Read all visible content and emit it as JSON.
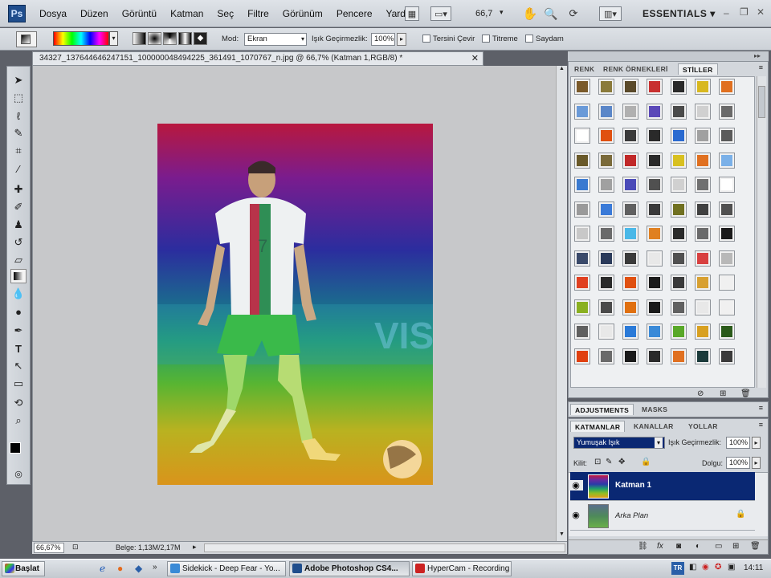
{
  "app": {
    "logo": "Ps"
  },
  "menu": [
    "Dosya",
    "Düzen",
    "Görüntü",
    "Katman",
    "Seç",
    "Filtre",
    "Görünüm",
    "Pencere",
    "Yardım"
  ],
  "zoom_readout": "66,7",
  "workspace": "ESSENTIALS",
  "options": {
    "mode_label": "Mod:",
    "mode_value": "Ekran",
    "opacity_label": "Işık Geçirmezlik:",
    "opacity_value": "100%",
    "reverse_label": "Tersini Çevir",
    "dither_label": "Titreme",
    "transparency_label": "Saydam"
  },
  "document": {
    "tab_title": "34327_137644646247151_100000048494225_361491_1070767_n.jpg @ 66,7% (Katman 1,RGB/8) *",
    "status_zoom": "66,67%",
    "status_doc": "Belge: 1,13M/2,17M"
  },
  "styles_panel": {
    "tabs": [
      "RENK",
      "RENK ÖRNEKLERİ",
      "STİLLER"
    ],
    "active": "STİLLER"
  },
  "adjust_panel": {
    "tabs": [
      "ADJUSTMENTS",
      "MASKS"
    ]
  },
  "layers_panel": {
    "tabs": [
      "KATMANLAR",
      "KANALLAR",
      "YOLLAR"
    ],
    "blend_mode": "Yumuşak Işık",
    "opacity_label": "Işık Geçirmezlik:",
    "opacity_value": "100%",
    "lock_label": "Kilit:",
    "fill_label": "Dolgu:",
    "fill_value": "100%",
    "layers": [
      {
        "name": "Katman 1",
        "selected": true
      },
      {
        "name": "Arka Plan",
        "selected": false,
        "locked": true
      }
    ]
  },
  "taskbar": {
    "start": "Başlat",
    "tasks": [
      "Sidekick - Deep Fear - Yo...",
      "Adobe Photoshop CS4...",
      "HyperCam - Recording"
    ],
    "lang": "TR",
    "clock": "14:11"
  },
  "jersey_number": "7",
  "colors": {
    "selection": "#0a2873",
    "accent_blue": "#1f4d8c"
  }
}
